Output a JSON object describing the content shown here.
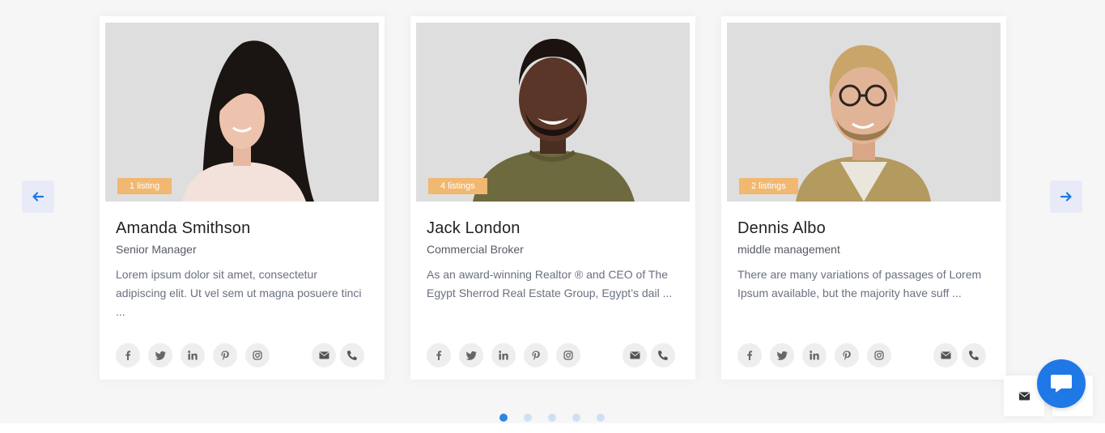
{
  "carousel": {
    "prev_icon": "arrow-left-icon",
    "next_icon": "arrow-right-icon",
    "dot_count": 5,
    "active_dot": 0
  },
  "agents": [
    {
      "listings": "1 listing",
      "name": "Amanda Smithson",
      "role": "Senior Manager",
      "bio": "Lorem ipsum dolor sit amet, consectetur adipiscing elit. Ut vel sem ut magna posuere tinci ..."
    },
    {
      "listings": "4 listings",
      "name": "Jack London",
      "role": "Commercial Broker",
      "bio": "As an award-winning Realtor ® and CEO of The Egypt Sherrod Real Estate Group, Egypt’s dail ..."
    },
    {
      "listings": "2 listings",
      "name": "Dennis Albo",
      "role": "middle management",
      "bio": "There are many variations of passages of Lorem Ipsum available, but the majority have suff ..."
    }
  ],
  "social_icons": [
    "facebook-icon",
    "twitter-icon",
    "linkedin-icon",
    "pinterest-icon",
    "instagram-icon"
  ],
  "contact_icons": [
    "envelope-icon",
    "phone-icon"
  ],
  "colors": {
    "accent": "#1e78e6",
    "badge": "#f0b870",
    "dot_active": "#2f86df",
    "dot_inactive": "#cfe0f4"
  }
}
